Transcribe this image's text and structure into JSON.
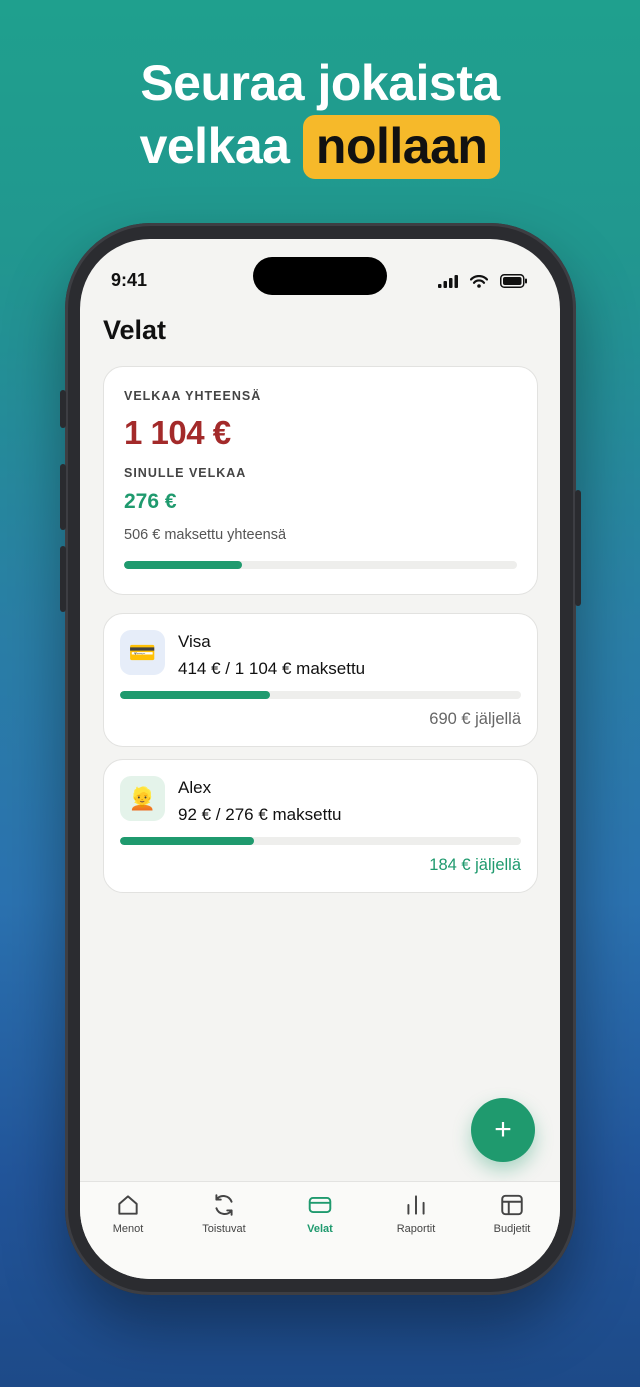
{
  "headline": {
    "line1": "Seuraa jokaista",
    "line2_pre": "velkaa",
    "line2_highlight": "nollaan"
  },
  "status_bar": {
    "time": "9:41"
  },
  "page": {
    "title": "Velat"
  },
  "summary": {
    "total_label": "VELKAA YHTEENSÄ",
    "total_value": "1 104 €",
    "owed_label": "SINULLE VELKAA",
    "owed_value": "276 €",
    "paid_total": "506 € maksettu yhteensä",
    "progress": 0.3
  },
  "debts": [
    {
      "icon": "credit-card-icon",
      "glyph": "💳",
      "name": "Visa",
      "paid": "414 € / 1 104 € maksettu",
      "remaining": "690 € jäljellä",
      "progress": 0.375,
      "remaining_color": "#666666",
      "icon_bg": "#e6edf9"
    },
    {
      "icon": "person-icon",
      "glyph": "👱",
      "name": "Alex",
      "paid": "92 € / 276 € maksettu",
      "remaining": "184 € jäljellä",
      "progress": 0.333,
      "remaining_color": "#1f9a6e",
      "icon_bg": "#e4f3ea"
    }
  ],
  "fab": {
    "label": "+"
  },
  "tabs": [
    {
      "label": "Menot",
      "icon": "home-icon",
      "active": false
    },
    {
      "label": "Toistuvat",
      "icon": "refresh-icon",
      "active": false
    },
    {
      "label": "Velat",
      "icon": "card-icon",
      "active": true
    },
    {
      "label": "Raportit",
      "icon": "bar-chart-icon",
      "active": false
    },
    {
      "label": "Budjetit",
      "icon": "budget-icon",
      "active": false
    }
  ],
  "colors": {
    "accent": "#1f9a6e",
    "debt_red": "#a32a2a",
    "highlight": "#f6b92a"
  }
}
